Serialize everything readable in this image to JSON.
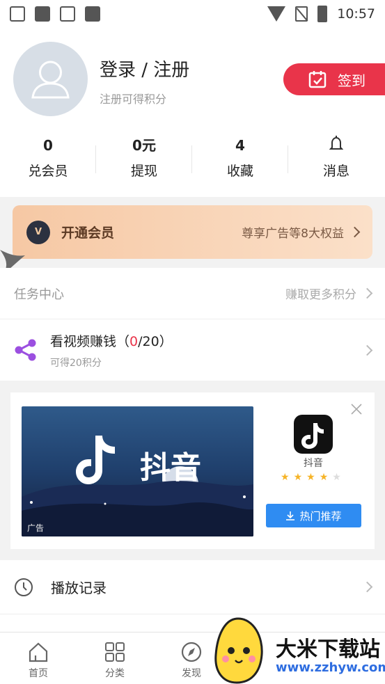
{
  "status_bar": {
    "time": "10:57"
  },
  "profile": {
    "name": "登录 / 注册",
    "subtitle": "注册可得积分",
    "checkin_label": "签到"
  },
  "stats": [
    {
      "value": "0",
      "label": "兑会员"
    },
    {
      "value": "0元",
      "label": "提现"
    },
    {
      "value": "4",
      "label": "收藏"
    },
    {
      "value": "",
      "label": "消息",
      "icon": "bell-icon"
    }
  ],
  "vip": {
    "badge": "V",
    "title": "开通会员",
    "desc": "尊享广告等8大权益"
  },
  "tasks": {
    "header": "任务中心",
    "header_action": "赚取更多积分",
    "item": {
      "title_prefix": "看视频赚钱（",
      "title_done": "0",
      "title_suffix": "/20）",
      "sub": "可得20积分",
      "icon": "share-icon"
    }
  },
  "ad": {
    "image_text": "抖音",
    "ad_tag": "广告",
    "app_name": "抖音",
    "rating": 4,
    "button": "热门推荐"
  },
  "history": {
    "title": "播放记录"
  },
  "tabs": [
    {
      "label": "首页",
      "icon": "home-icon"
    },
    {
      "label": "分类",
      "icon": "grid-icon"
    },
    {
      "label": "发现",
      "icon": "compass-icon"
    }
  ],
  "watermark": {
    "line1": "大米下载站",
    "line2": "www.zzhyw.com"
  },
  "colors": {
    "accent_red": "#e9344a",
    "blue_button": "#2f8cf2",
    "vip_gradient": "#f6c8a4"
  }
}
